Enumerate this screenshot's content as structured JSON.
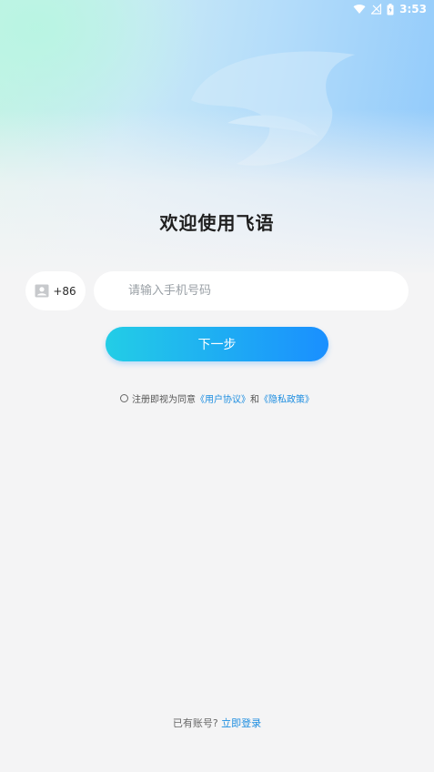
{
  "status_bar": {
    "time": "3:53"
  },
  "title": "欢迎使用飞语",
  "phone_form": {
    "country_code": "+86",
    "phone_placeholder": "请输入手机号码",
    "phone_value": ""
  },
  "next_button": {
    "label": "下一步"
  },
  "agreement": {
    "prefix": "注册即视为同意",
    "user_agreement": "《用户协议》",
    "conjunction": "和",
    "privacy_policy": "《隐私政策》"
  },
  "login_prompt": {
    "text": "已有账号?",
    "link": "立即登录"
  },
  "colors": {
    "primary_gradient_start": "#23cde6",
    "primary_gradient_end": "#1a8fff",
    "link": "#1c8de0",
    "background": "#f4f4f5"
  },
  "icons": {
    "wifi": "wifi-icon",
    "signal": "no-signal-icon",
    "battery": "battery-charging-icon",
    "contact": "contact-card-icon"
  }
}
